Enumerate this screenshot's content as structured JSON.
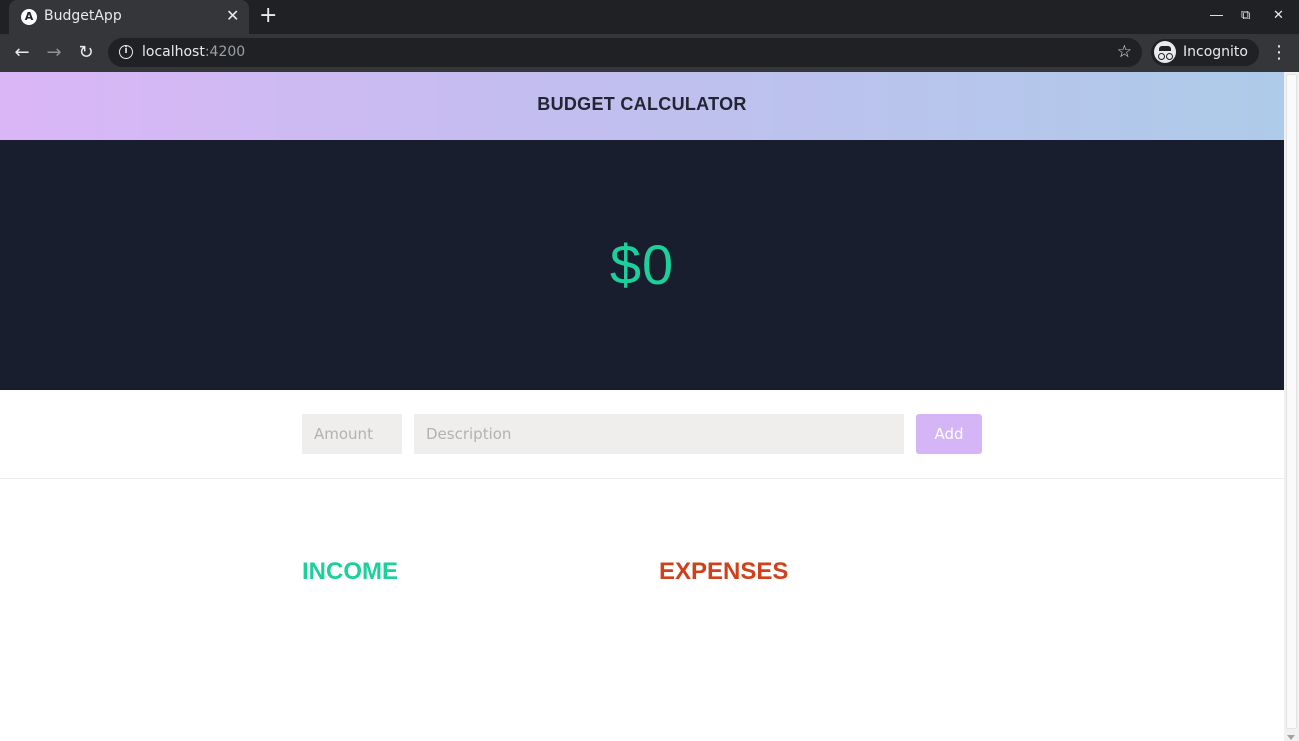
{
  "browser": {
    "tab_title": "BudgetApp",
    "tab_favicon": "A",
    "tab_close": "✕",
    "new_tab": "+",
    "url_host": "localhost",
    "url_port": ":4200",
    "profile_label": "Incognito"
  },
  "app": {
    "title": "BUDGET CALCULATOR",
    "balance": "$0",
    "form": {
      "amount_placeholder": "Amount",
      "description_placeholder": "Description",
      "add_label": "Add"
    },
    "income_heading": "INCOME",
    "expenses_heading": "EXPENSES"
  },
  "colors": {
    "header_gradient": [
      "#dbb6f7",
      "#aecbe9"
    ],
    "panel_bg": "#181e2e",
    "income": "#1dcf9b",
    "expenses": "#d0401a",
    "add_button": "#d5b5f6"
  }
}
